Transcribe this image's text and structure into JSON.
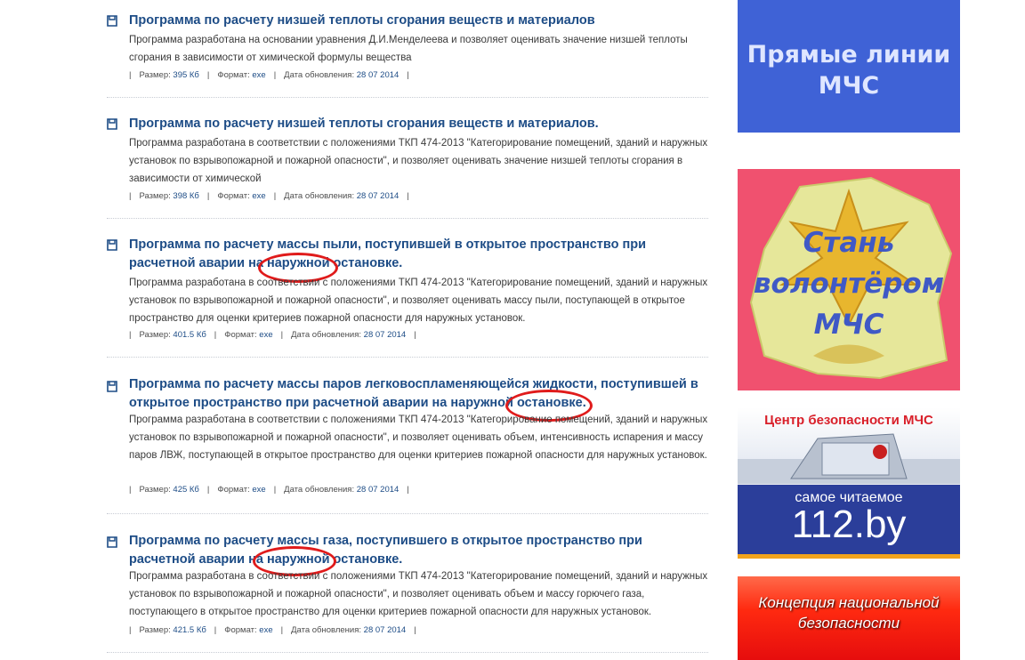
{
  "items": [
    {
      "title": "Программа по расчету низшей теплоты сгорания веществ и материалов",
      "description": "Программа разработана на основании уравнения Д.И.Менделеева и позволяет оценивать значение низшей теплоты сгорания в зависимости от химической формулы вещества",
      "size_label": "Размер:",
      "size": "395 Кб",
      "format_label": "Формат:",
      "format": "exe",
      "date_label": "Дата обновления:",
      "date": "28 07 2014"
    },
    {
      "title": "Программа по расчету низшей теплоты сгорания веществ и материалов.",
      "description": "Программа разработана в соответствии с положениями ТКП 474-2013 \"Категорирование помещений, зданий и наружных установок по взрывопожарной и пожарной опасности\", и позволяет оценивать значение низшей теплоты сгорания в зависимости от химической",
      "size_label": "Размер:",
      "size": "398 Кб",
      "format_label": "Формат:",
      "format": "exe",
      "date_label": "Дата обновления:",
      "date": "28 07 2014"
    },
    {
      "title": "Программа по расчету массы пыли, поступившей в открытое пространство при расчетной аварии на наружной остановке.",
      "description": "Программа разработана в соответствии с положениями ТКП 474-2013 \"Категорирование помещений, зданий и наружных установок по взрывопожарной и пожарной опасности\", и позволяет оценивать массу пыли, поступающей в открытое пространство для оценки критериев пожарной опасности для наружных установок.",
      "size_label": "Размер:",
      "size": "401.5 Кб",
      "format_label": "Формат:",
      "format": "exe",
      "date_label": "Дата обновления:",
      "date": "28 07 2014"
    },
    {
      "title": "Программа по расчету массы паров легковоспламеняющейся жидкости, поступившей в открытое пространство при расчетной аварии на наружной остановке.",
      "description": "Программа разработана в соответствии с положениями ТКП 474-2013 \"Категорирование помещений, зданий и наружных установок по взрывопожарной и пожарной опасности\", и позволяет оценивать объем, интенсивность испарения и массу паров ЛВЖ, поступающей в открытое пространство для оценки критериев пожарной опасности для наружных установок.",
      "size_label": "Размер:",
      "size": "425 Кб",
      "format_label": "Формат:",
      "format": "exe",
      "date_label": "Дата обновления:",
      "date": "28 07 2014"
    },
    {
      "title": "Программа по расчету массы газа, поступившего в открытое пространство при расчетной аварии на наружной остановке.",
      "description": "Программа разработана в соответствии с положениями ТКП 474-2013 \"Категорирование помещений, зданий и наружных установок по взрывопожарной и пожарной опасности\", и позволяет оценивать объем и массу горючего газа, поступающего в открытое пространство для оценки критериев пожарной опасности для наружных установок.",
      "size_label": "Размер:",
      "size": "421.5 Кб",
      "format_label": "Формат:",
      "format": "exe",
      "date_label": "Дата обновления:",
      "date": "28 07 2014"
    }
  ],
  "banners": {
    "direct_lines": "Прямые линии МЧС",
    "volunteer": "Стань волонтёром МЧС",
    "safety_center": "Центр безопасности МЧС",
    "most_read": "самое читаемое",
    "site_112": "112.by",
    "concept": "Концепция национальной безопасности"
  },
  "colors": {
    "link": "#1d4c86",
    "annotation_circle": "#e01b1b",
    "banner_blue": "#3f62d6",
    "banner_pink": "#f0516f",
    "banner_red": "#e60d0d"
  }
}
